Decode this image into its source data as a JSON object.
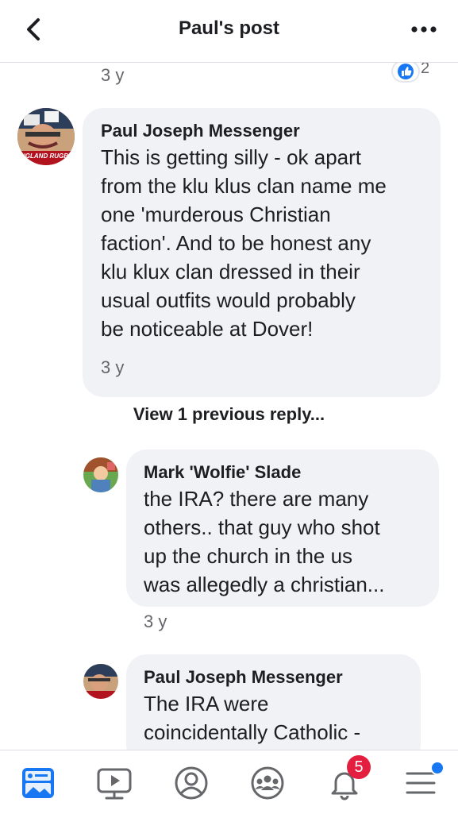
{
  "header": {
    "title": "Paul's post",
    "back_icon": "chevron-left-icon",
    "more_icon": "more-horizontal-icon"
  },
  "top_reply": {
    "time": "3 y",
    "like_count": "2"
  },
  "comments": [
    {
      "author": "Paul Joseph Messenger",
      "lines": [
        "This is getting silly - ok apart",
        "from the klu klus clan name me",
        "one 'murderous Christian",
        "faction'. And to be honest any",
        "klu klux clan  dressed in their",
        "usual outfits would probably",
        "be noticeable at Dover!"
      ],
      "time": "3 y",
      "avatar_text": "NGLAND RUGB"
    },
    {
      "author": "Mark 'Wolfie' Slade",
      "lines": [
        "the IRA?  there are many",
        "others..  that guy who shot",
        "up the church in the us",
        "was allegedly a christian..."
      ],
      "time": "3 y"
    },
    {
      "author": "Paul Joseph Messenger",
      "lines": [
        "The IRA were",
        "coincidentally Catholic -"
      ]
    }
  ],
  "view_previous": "View 1 previous reply...",
  "bottom_nav": {
    "items": [
      "news-feed-icon",
      "watch-video-icon",
      "profile-icon",
      "groups-icon",
      "notifications-bell-icon",
      "menu-icon"
    ],
    "notifications_badge": "5"
  },
  "colors": {
    "accent": "#1877f2",
    "bubble": "#f0f2f5",
    "badge": "#e41e3f",
    "secondary_text": "#65676b"
  }
}
